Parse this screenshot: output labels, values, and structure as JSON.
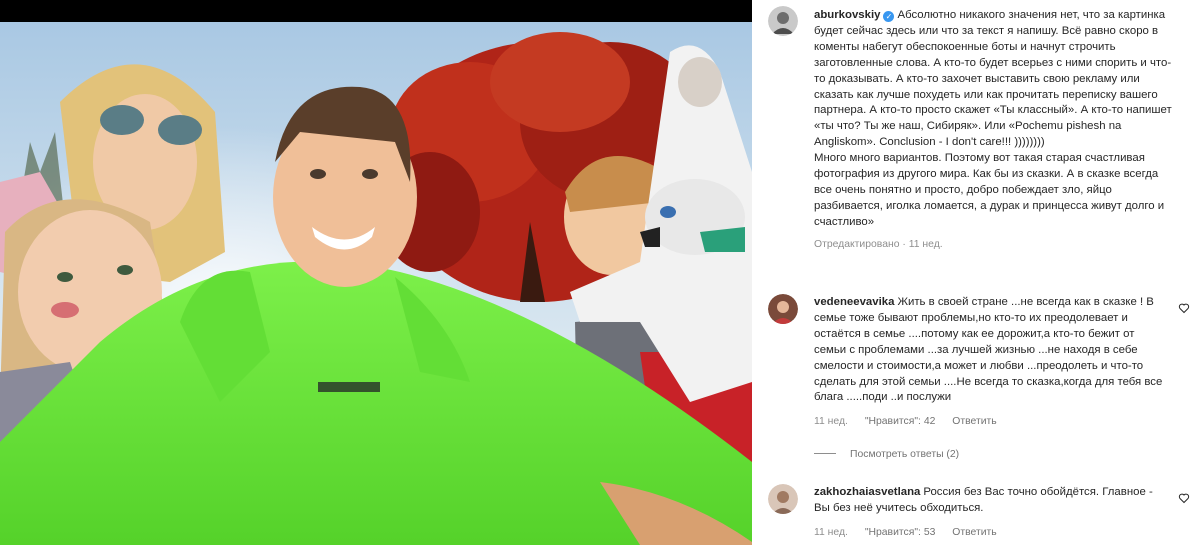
{
  "post": {
    "username": "aburkovskiy",
    "verified_icon": "verified-badge-icon",
    "caption": "Абсолютно никакого значения нет, что за картинка будет сейчас здесь или что за текст я напишу. Всё равно скоро в коменты набегут обеспокоенные боты и начнут строчить заготовленные слова. А кто-то будет всерьез с ними спорить и что-то доказывать. А кто-то захочет выставить свою рекламу или сказать как лучше похудеть или как прочитать переписку вашего партнера. А кто-то просто скажет «Ты классный». А кто-то напишет «ты что? Ты же наш, Сибиряк». Или «Pochemu pishesh na Angliskom». Conclusion - I don't care!!! ))))))))",
    "caption_2": "Много много вариантов. Поэтому вот такая старая счастливая фотография из другого мира. Как бы из сказки. А в сказке всегда все очень понятно и просто, добро побеждает зло, яйцо разбивается, иголка ломается, а дурак и принцесса живут долго и счастливо»",
    "edited": "Отредактировано",
    "separator": "·",
    "time": "11 нед."
  },
  "comments": [
    {
      "username": "vedeneevavika",
      "text": "Жить в своей стране ...не всегда как в сказке ! В семье тоже бывают проблемы,но кто-то их преодолевает и остаётся в семье ....потому как ее дорожит,а кто-то бежит от семьи с проблемами ...за лучшей жизнью ...не находя в себе смелости и стоимости,а может и любви ...преодолеть и что-то сделать для этой семьи ....Не всегда то сказка,когда для тебя все блага .....поди ..и послужи",
      "time": "11 нед.",
      "likes": "\"Нравится\": 42",
      "reply": "Ответить"
    },
    {
      "username": "zakhozhaiasvetlana",
      "text": "Россия без Вас точно обойдётся. Главное - Вы без неё учитесь обходиться.",
      "time": "11 нед.",
      "likes": "\"Нравится\": 53",
      "reply": "Ответить"
    }
  ],
  "view_replies": "Посмотреть ответы (2)",
  "colors": {
    "hoodie": "#6ee83a",
    "sky": "#bcd6ea",
    "tree": "#b02418",
    "link": "#262626",
    "muted": "#8e8e8e",
    "verified": "#3897f0"
  }
}
